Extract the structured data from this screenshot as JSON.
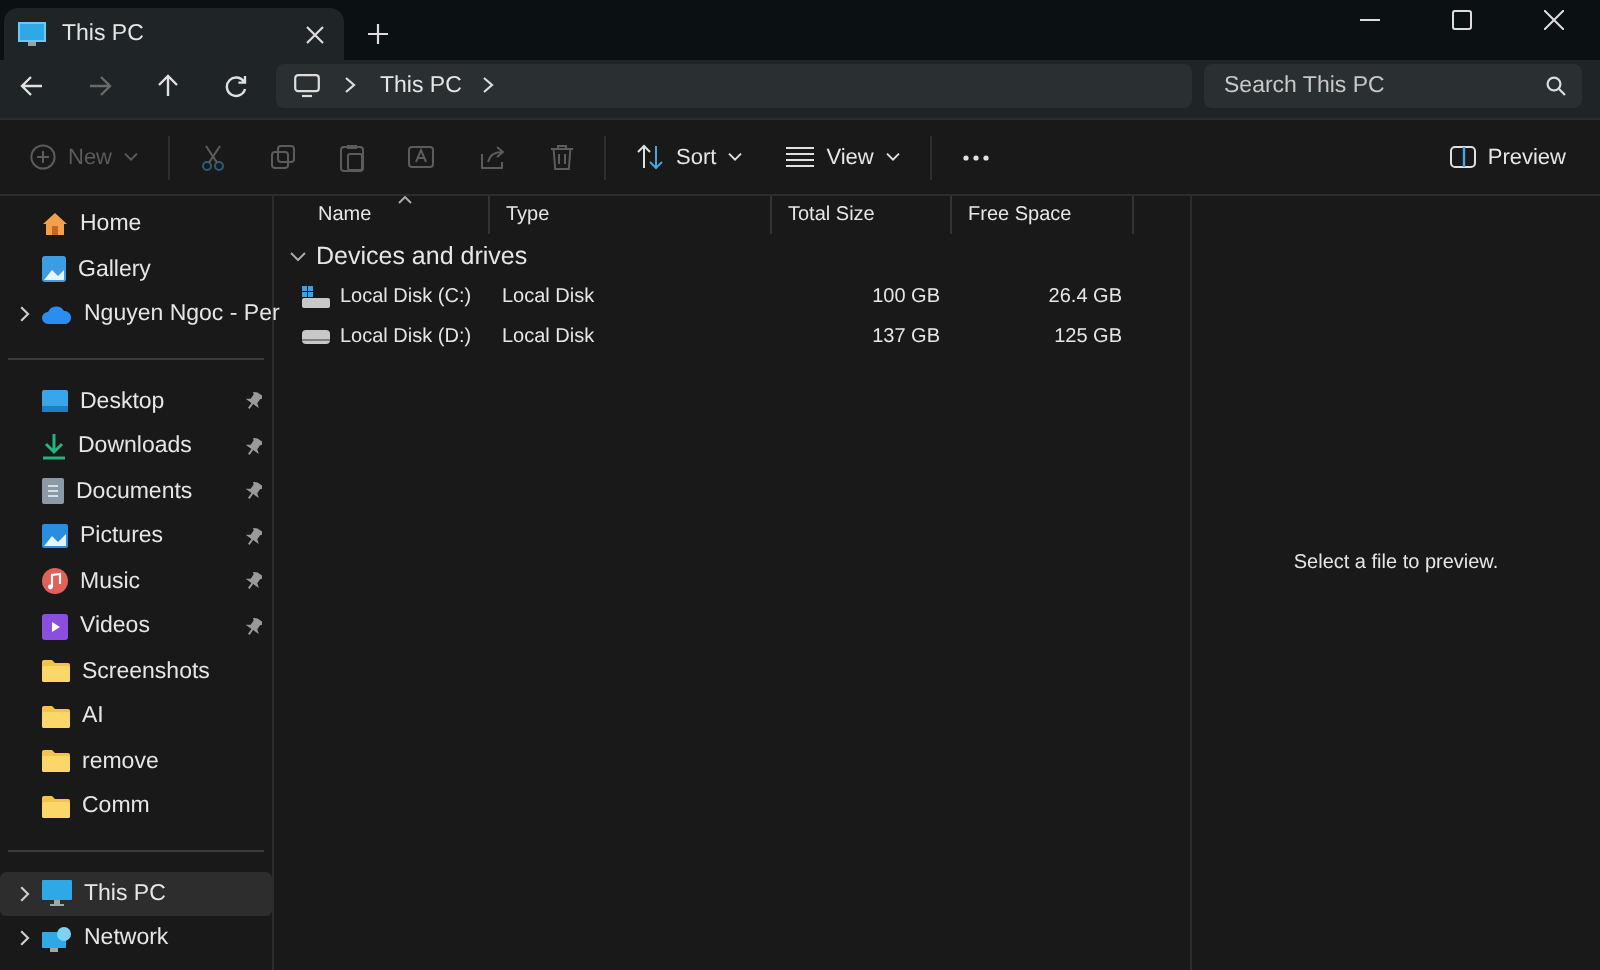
{
  "window": {
    "tabs": [
      {
        "title": "This PC",
        "selected": true
      }
    ]
  },
  "navigation": {
    "back_disabled": false,
    "forward_disabled": true,
    "breadcrumbs": [
      "This PC"
    ],
    "search": {
      "placeholder": "Search This PC"
    }
  },
  "toolbar": {
    "items": [
      {
        "kind": "new",
        "label": "New",
        "disabled": true
      },
      {
        "kind": "cut",
        "disabled": true
      },
      {
        "kind": "copy",
        "disabled": true
      },
      {
        "kind": "paste",
        "disabled": true
      },
      {
        "kind": "rename",
        "disabled": true
      },
      {
        "kind": "share",
        "disabled": true
      },
      {
        "kind": "delete",
        "disabled": true
      },
      {
        "kind": "sort",
        "label": "Sort",
        "disabled": false
      },
      {
        "kind": "view",
        "label": "View",
        "disabled": false
      },
      {
        "kind": "more",
        "disabled": false
      }
    ],
    "preview": {
      "label": "Preview"
    }
  },
  "sidebar": {
    "groups": [
      [
        {
          "label": "Home",
          "kind": "home",
          "pinned": false,
          "expandable": false,
          "selected": false
        },
        {
          "label": "Gallery",
          "kind": "gallery",
          "pinned": false,
          "expandable": false,
          "selected": false
        },
        {
          "label": "Nguyen Ngoc - Per",
          "kind": "cloud",
          "pinned": false,
          "expandable": true,
          "selected": false
        }
      ],
      [
        {
          "label": "Desktop",
          "kind": "desktop",
          "pinned": true,
          "expandable": false,
          "selected": false
        },
        {
          "label": "Downloads",
          "kind": "download",
          "pinned": true,
          "expandable": false,
          "selected": false
        },
        {
          "label": "Documents",
          "kind": "document",
          "pinned": true,
          "expandable": false,
          "selected": false
        },
        {
          "label": "Pictures",
          "kind": "pictures",
          "pinned": true,
          "expandable": false,
          "selected": false
        },
        {
          "label": "Music",
          "kind": "music",
          "pinned": true,
          "expandable": false,
          "selected": false
        },
        {
          "label": "Videos",
          "kind": "videos",
          "pinned": true,
          "expandable": false,
          "selected": false
        },
        {
          "label": "Screenshots",
          "kind": "folder",
          "pinned": false,
          "expandable": false,
          "selected": false
        },
        {
          "label": "AI",
          "kind": "folder",
          "pinned": false,
          "expandable": false,
          "selected": false
        },
        {
          "label": "remove",
          "kind": "folder",
          "pinned": false,
          "expandable": false,
          "selected": false
        },
        {
          "label": "Comm",
          "kind": "folder",
          "pinned": false,
          "expandable": false,
          "selected": false
        }
      ],
      [
        {
          "label": "This PC",
          "kind": "pc",
          "pinned": false,
          "expandable": true,
          "selected": true
        },
        {
          "label": "Network",
          "kind": "network",
          "pinned": false,
          "expandable": true,
          "selected": false
        }
      ]
    ]
  },
  "table": {
    "columns": [
      {
        "label": "Name",
        "sorted": true
      },
      {
        "label": "Type",
        "sorted": false
      },
      {
        "label": "Total Size",
        "sorted": false
      },
      {
        "label": "Free Space",
        "sorted": false
      }
    ],
    "groups": [
      {
        "title": "Devices and drives",
        "expanded": true,
        "rows": [
          {
            "kind": "system-drive",
            "cells": [
              "Local Disk (C:)",
              "Local Disk",
              "100 GB",
              "26.4 GB"
            ]
          },
          {
            "kind": "drive",
            "cells": [
              "Local Disk (D:)",
              "Local Disk",
              "137 GB",
              "125 GB"
            ]
          }
        ]
      }
    ]
  },
  "preview_pane": {
    "message": "Select a file to preview."
  }
}
